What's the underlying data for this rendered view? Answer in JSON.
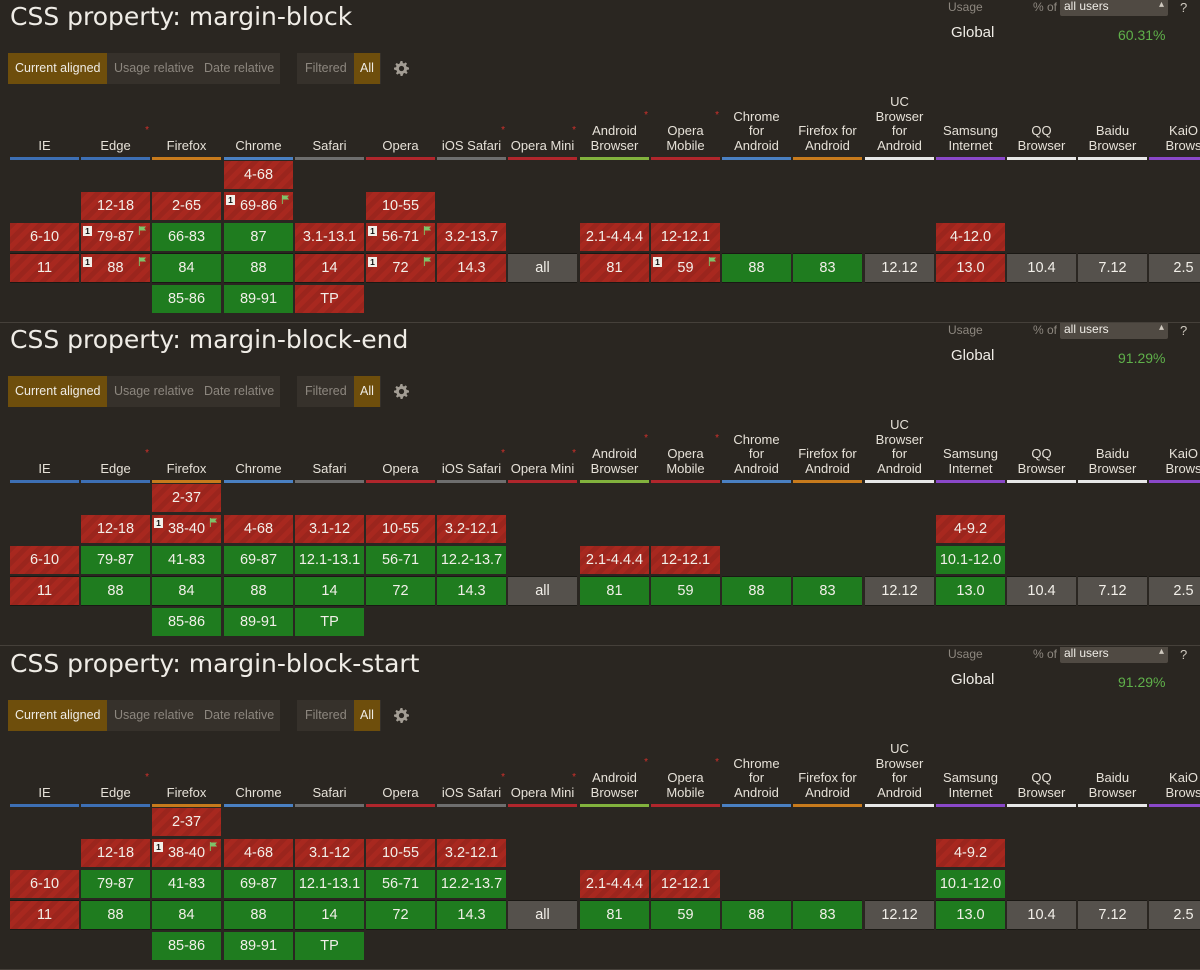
{
  "colors": {
    "unsupported": "#a8281f",
    "supported": "#1f7c1f",
    "unknown": "#55514c",
    "active_button": "#6e4e0c",
    "usage_value": "#5fb04a",
    "note_star": "#d0302b"
  },
  "usage": {
    "label": "Usage",
    "pct_of": "% of",
    "users_option": "all users",
    "help": "?",
    "global_label": "Global"
  },
  "modes": {
    "current_aligned": "Current aligned",
    "usage_relative": "Usage relative",
    "date_relative": "Date relative",
    "filtered": "Filtered",
    "all": "All"
  },
  "browsers": [
    {
      "name": "IE",
      "lines": [
        "IE"
      ],
      "note": false,
      "color": "#3d6fb4"
    },
    {
      "name": "Edge",
      "lines": [
        "Edge"
      ],
      "note": true,
      "color": "#3d6fb4"
    },
    {
      "name": "Firefox",
      "lines": [
        "Firefox"
      ],
      "note": false,
      "color": "#c77a1c"
    },
    {
      "name": "Chrome",
      "lines": [
        "Chrome"
      ],
      "note": false,
      "color": "#4a80c2"
    },
    {
      "name": "Safari",
      "lines": [
        "Safari"
      ],
      "note": false,
      "color": "#6e6e6e"
    },
    {
      "name": "Opera",
      "lines": [
        "Opera"
      ],
      "note": false,
      "color": "#b0262c"
    },
    {
      "name": "iOS Safari",
      "lines": [
        "iOS Safari"
      ],
      "note": true,
      "color": "#6e6e6e"
    },
    {
      "name": "Opera Mini",
      "lines": [
        "Opera Mini"
      ],
      "note": true,
      "color": "#b0262c"
    },
    {
      "name": "Android Browser",
      "lines": [
        "Android",
        "Browser"
      ],
      "note": true,
      "color": "#82b23d"
    },
    {
      "name": "Opera Mobile",
      "lines": [
        "Opera",
        "Mobile"
      ],
      "note": true,
      "color": "#b0262c"
    },
    {
      "name": "Chrome for Android",
      "lines": [
        "Chrome",
        "for",
        "Android"
      ],
      "note": false,
      "color": "#4a80c2"
    },
    {
      "name": "Firefox for Android",
      "lines": [
        "Firefox for",
        "Android"
      ],
      "note": false,
      "color": "#c77a1c"
    },
    {
      "name": "UC Browser for Android",
      "lines": [
        "UC",
        "Browser",
        "for",
        "Android"
      ],
      "note": false,
      "color": "#e8e8e8"
    },
    {
      "name": "Samsung Internet",
      "lines": [
        "Samsung",
        "Internet"
      ],
      "note": false,
      "color": "#8a48c9"
    },
    {
      "name": "QQ Browser",
      "lines": [
        "QQ",
        "Browser"
      ],
      "note": false,
      "color": "#e8e8e8"
    },
    {
      "name": "Baidu Browser",
      "lines": [
        "Baidu",
        "Browser"
      ],
      "note": false,
      "color": "#e8e8e8"
    },
    {
      "name": "KaiOS Browser",
      "lines": [
        "KaiO",
        "Brows"
      ],
      "note": false,
      "color": "#8a48c9"
    }
  ],
  "sections": [
    {
      "title": "CSS property: margin-block",
      "global_usage": "60.31%",
      "columns": [
        [
          [
            "6-10",
            "n",
            0
          ],
          [
            "11",
            "n",
            0
          ]
        ],
        [
          [
            "12-18",
            "n",
            0
          ],
          [
            "79-87",
            "n",
            1,
            true
          ],
          [
            "88",
            "n",
            1,
            true
          ]
        ],
        [
          [
            "2-65",
            "n",
            0
          ],
          [
            "66-83",
            "y",
            0
          ],
          [
            "84",
            "y",
            0
          ],
          [
            "85-86",
            "y",
            0
          ]
        ],
        [
          [
            "4-68",
            "n",
            0
          ],
          [
            "69-86",
            "n",
            1,
            true
          ],
          [
            "87",
            "y",
            0
          ],
          [
            "88",
            "y",
            0
          ],
          [
            "89-91",
            "y",
            0
          ]
        ],
        [
          [
            "3.1-13.1",
            "n",
            0
          ],
          [
            "14",
            "n",
            0
          ],
          [
            "TP",
            "n",
            0
          ]
        ],
        [
          [
            "10-55",
            "n",
            0
          ],
          [
            "56-71",
            "n",
            1,
            true
          ],
          [
            "72",
            "n",
            1,
            true
          ]
        ],
        [
          [
            "3.2-13.7",
            "n",
            0
          ],
          [
            "14.3",
            "n",
            0
          ]
        ],
        [
          [
            "all",
            "u",
            0
          ]
        ],
        [
          [
            "2.1-4.4.4",
            "n",
            0
          ],
          [
            "81",
            "n",
            0
          ]
        ],
        [
          [
            "12-12.1",
            "n",
            0
          ],
          [
            "59",
            "n",
            1,
            true
          ]
        ],
        [
          [
            "88",
            "y",
            0
          ]
        ],
        [
          [
            "83",
            "y",
            0
          ]
        ],
        [
          [
            "12.12",
            "u",
            0
          ]
        ],
        [
          [
            "4-12.0",
            "n",
            0
          ],
          [
            "13.0",
            "n",
            0
          ]
        ],
        [
          [
            "10.4",
            "u",
            0
          ]
        ],
        [
          [
            "7.12",
            "u",
            0
          ]
        ],
        [
          [
            "2.5",
            "u",
            0
          ]
        ]
      ]
    },
    {
      "title": "CSS property: margin-block-end",
      "global_usage": "91.29%",
      "columns": [
        [
          [
            "6-10",
            "n",
            0
          ],
          [
            "11",
            "n",
            0
          ]
        ],
        [
          [
            "12-18",
            "n",
            0
          ],
          [
            "79-87",
            "y",
            0
          ],
          [
            "88",
            "y",
            0
          ]
        ],
        [
          [
            "2-37",
            "n",
            0
          ],
          [
            "38-40",
            "n",
            1,
            true
          ],
          [
            "41-83",
            "y",
            0
          ],
          [
            "84",
            "y",
            0
          ],
          [
            "85-86",
            "y",
            0
          ]
        ],
        [
          [
            "4-68",
            "n",
            0
          ],
          [
            "69-87",
            "y",
            0
          ],
          [
            "88",
            "y",
            0
          ],
          [
            "89-91",
            "y",
            0
          ]
        ],
        [
          [
            "3.1-12",
            "n",
            0
          ],
          [
            "12.1-13.1",
            "y",
            0
          ],
          [
            "14",
            "y",
            0
          ],
          [
            "TP",
            "y",
            0
          ]
        ],
        [
          [
            "10-55",
            "n",
            0
          ],
          [
            "56-71",
            "y",
            0
          ],
          [
            "72",
            "y",
            0
          ]
        ],
        [
          [
            "3.2-12.1",
            "n",
            0
          ],
          [
            "12.2-13.7",
            "y",
            0
          ],
          [
            "14.3",
            "y",
            0
          ]
        ],
        [
          [
            "all",
            "u",
            0
          ]
        ],
        [
          [
            "2.1-4.4.4",
            "n",
            0
          ],
          [
            "81",
            "y",
            0
          ]
        ],
        [
          [
            "12-12.1",
            "n",
            0
          ],
          [
            "59",
            "y",
            0
          ]
        ],
        [
          [
            "88",
            "y",
            0
          ]
        ],
        [
          [
            "83",
            "y",
            0
          ]
        ],
        [
          [
            "12.12",
            "u",
            0
          ]
        ],
        [
          [
            "4-9.2",
            "n",
            0
          ],
          [
            "10.1-12.0",
            "y",
            0
          ],
          [
            "13.0",
            "y",
            0
          ]
        ],
        [
          [
            "10.4",
            "u",
            0
          ]
        ],
        [
          [
            "7.12",
            "u",
            0
          ]
        ],
        [
          [
            "2.5",
            "u",
            0
          ]
        ]
      ]
    },
    {
      "title": "CSS property: margin-block-start",
      "global_usage": "91.29%",
      "columns": [
        [
          [
            "6-10",
            "n",
            0
          ],
          [
            "11",
            "n",
            0
          ]
        ],
        [
          [
            "12-18",
            "n",
            0
          ],
          [
            "79-87",
            "y",
            0
          ],
          [
            "88",
            "y",
            0
          ]
        ],
        [
          [
            "2-37",
            "n",
            0
          ],
          [
            "38-40",
            "n",
            1,
            true
          ],
          [
            "41-83",
            "y",
            0
          ],
          [
            "84",
            "y",
            0
          ],
          [
            "85-86",
            "y",
            0
          ]
        ],
        [
          [
            "4-68",
            "n",
            0
          ],
          [
            "69-87",
            "y",
            0
          ],
          [
            "88",
            "y",
            0
          ],
          [
            "89-91",
            "y",
            0
          ]
        ],
        [
          [
            "3.1-12",
            "n",
            0
          ],
          [
            "12.1-13.1",
            "y",
            0
          ],
          [
            "14",
            "y",
            0
          ],
          [
            "TP",
            "y",
            0
          ]
        ],
        [
          [
            "10-55",
            "n",
            0
          ],
          [
            "56-71",
            "y",
            0
          ],
          [
            "72",
            "y",
            0
          ]
        ],
        [
          [
            "3.2-12.1",
            "n",
            0
          ],
          [
            "12.2-13.7",
            "y",
            0
          ],
          [
            "14.3",
            "y",
            0
          ]
        ],
        [
          [
            "all",
            "u",
            0
          ]
        ],
        [
          [
            "2.1-4.4.4",
            "n",
            0
          ],
          [
            "81",
            "y",
            0
          ]
        ],
        [
          [
            "12-12.1",
            "n",
            0
          ],
          [
            "59",
            "y",
            0
          ]
        ],
        [
          [
            "88",
            "y",
            0
          ]
        ],
        [
          [
            "83",
            "y",
            0
          ]
        ],
        [
          [
            "12.12",
            "u",
            0
          ]
        ],
        [
          [
            "4-9.2",
            "n",
            0
          ],
          [
            "10.1-12.0",
            "y",
            0
          ],
          [
            "13.0",
            "y",
            0
          ]
        ],
        [
          [
            "10.4",
            "u",
            0
          ]
        ],
        [
          [
            "7.12",
            "u",
            0
          ]
        ],
        [
          [
            "2.5",
            "u",
            0
          ]
        ]
      ]
    }
  ]
}
